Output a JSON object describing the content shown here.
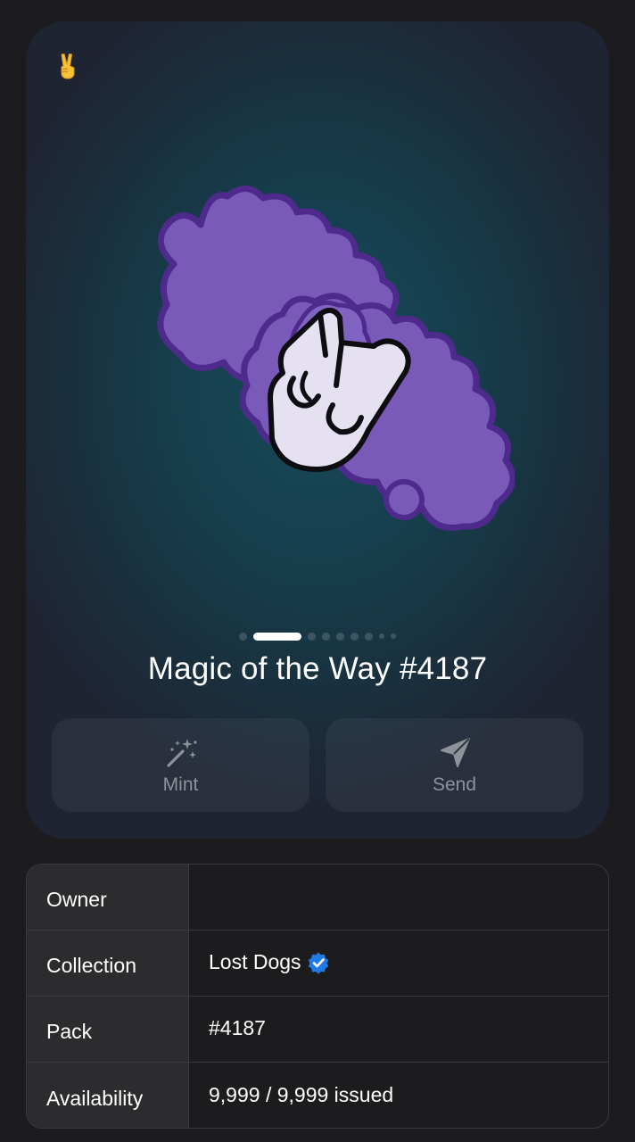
{
  "card": {
    "corner_icon": "victory-hand-emoji",
    "nft_title": "Magic of the Way #4187",
    "artwork": "peace-sign-hand-on-purple-cloud",
    "pagination": {
      "count": 10,
      "active_index": 1
    }
  },
  "actions": {
    "mint": {
      "label": "Mint",
      "icon": "magic-wand-icon"
    },
    "send": {
      "label": "Send",
      "icon": "paper-plane-icon"
    }
  },
  "details": {
    "owner": {
      "key": "Owner",
      "value": ""
    },
    "collection": {
      "key": "Collection",
      "value": "Lost Dogs",
      "verified_icon": "verified-badge-icon"
    },
    "pack": {
      "key": "Pack",
      "value": "#4187"
    },
    "availability": {
      "key": "Availability",
      "value": "9,999 / 9,999 issued"
    }
  },
  "colors": {
    "background": "#1c1c1e",
    "card_bg": "#174a58",
    "purple_cloud": "#7a5ab8",
    "purple_outline": "#4e2a8c",
    "hand_fill": "#e6e1f1",
    "verified_blue": "#1f7ae6"
  }
}
